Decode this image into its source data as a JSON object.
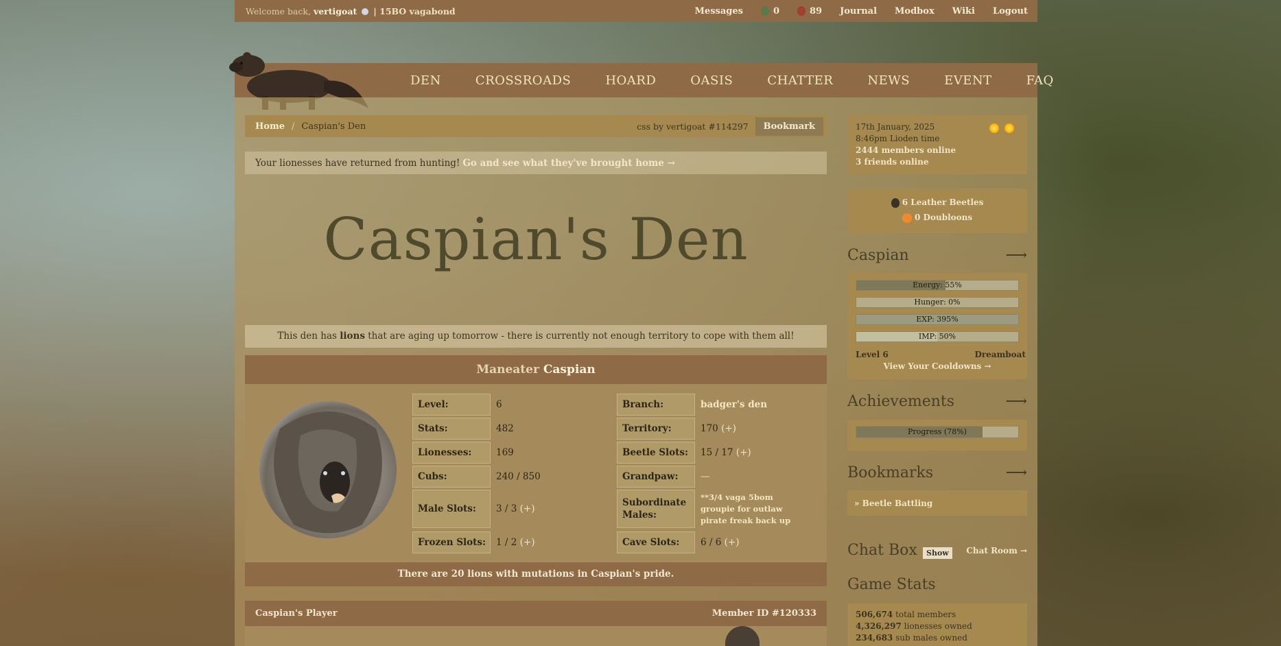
{
  "topbar": {
    "welcome_prefix": "Welcome back,",
    "username": "vertigoat",
    "suffix": "| 15BO vagabond",
    "messages": "Messages",
    "green_beetle_count": "0",
    "red_beetle_count": "89",
    "journal": "Journal",
    "modbox": "Modbox",
    "wiki": "Wiki",
    "logout": "Logout"
  },
  "nav": [
    "DEN",
    "CROSSROADS",
    "HOARD",
    "OASIS",
    "CHATTER",
    "NEWS",
    "EVENT",
    "FAQ"
  ],
  "breadcrumb": {
    "home": "Home",
    "sep": "/",
    "current": "Caspian's Den",
    "css_credit": "css by vertigoat #114297",
    "bookmark": "Bookmark"
  },
  "notice": {
    "text": "Your lionesses have returned from hunting!",
    "link": "Go and see what they've brought home →"
  },
  "den_title": "Caspian's Den",
  "warning": {
    "before": "This den has",
    "bold": "lions",
    "after": "that are aging up tomorrow - there is currently not enough territory to cope with them all!"
  },
  "lion": {
    "title": "Maneater",
    "name": "Caspian",
    "level_label": "Level:",
    "level": "6",
    "stats_label": "Stats:",
    "stats": "482",
    "lionesses_label": "Lionesses:",
    "lionesses": "169",
    "cubs_label": "Cubs:",
    "cubs": "240 / 850",
    "male_slots_label": "Male Slots:",
    "male_slots": "3 / 3",
    "frozen_slots_label": "Frozen Slots:",
    "frozen_slots": "1 / 2",
    "branch_label": "Branch:",
    "branch": "badger's den",
    "territory_label": "Territory:",
    "territory": "170",
    "beetle_slots_label": "Beetle Slots:",
    "beetle_slots": "15 / 17",
    "grandpaw_label": "Grandpaw:",
    "grandpaw": "—",
    "subordinate_label": "Subordinate Males:",
    "subordinates": [
      "**3/4 vaga 5bom",
      "groupie for outlaw",
      "pirate freak back up"
    ],
    "cave_slots_label": "Cave Slots:",
    "cave_slots": "6 / 6",
    "plus": "(+)"
  },
  "mutation_text": "There are 20 lions with mutations in Caspian's pride.",
  "player": {
    "label": "Caspian's Player",
    "member_id": "Member ID #120333"
  },
  "sidebar": {
    "date": "17th January, 2025",
    "time": "8:46pm Lioden time",
    "members_online": "2444 members online",
    "friends_online": "3 friends online",
    "beetles": "6 Leather Beetles",
    "doubloons": "0 Doubloons",
    "lion_name": "Caspian",
    "bars": [
      {
        "label": "Energy: 55%",
        "value": 55
      },
      {
        "label": "Hunger: 0%",
        "value": 0
      },
      {
        "label": "EXP: 395%",
        "value": 100
      },
      {
        "label": "IMP: 50%",
        "value": 50
      }
    ],
    "level": "Level 6",
    "rank": "Dreamboat",
    "cooldowns": "View Your Cooldowns →",
    "achievements": "Achievements",
    "progress_label": "Progress (78%)",
    "progress_value": 78,
    "bookmarks": "Bookmarks",
    "bookmark_item": "» Beetle Battling",
    "chatbox": "Chat Box",
    "show": "Show",
    "chat_room": "Chat Room →",
    "game_stats": "Game Stats",
    "stats": [
      {
        "num": "506,674",
        "label": "total members"
      },
      {
        "num": "4,326,297",
        "label": "lionesses owned"
      },
      {
        "num": "234,683",
        "label": "sub males owned"
      }
    ],
    "arrow": "⟶"
  }
}
